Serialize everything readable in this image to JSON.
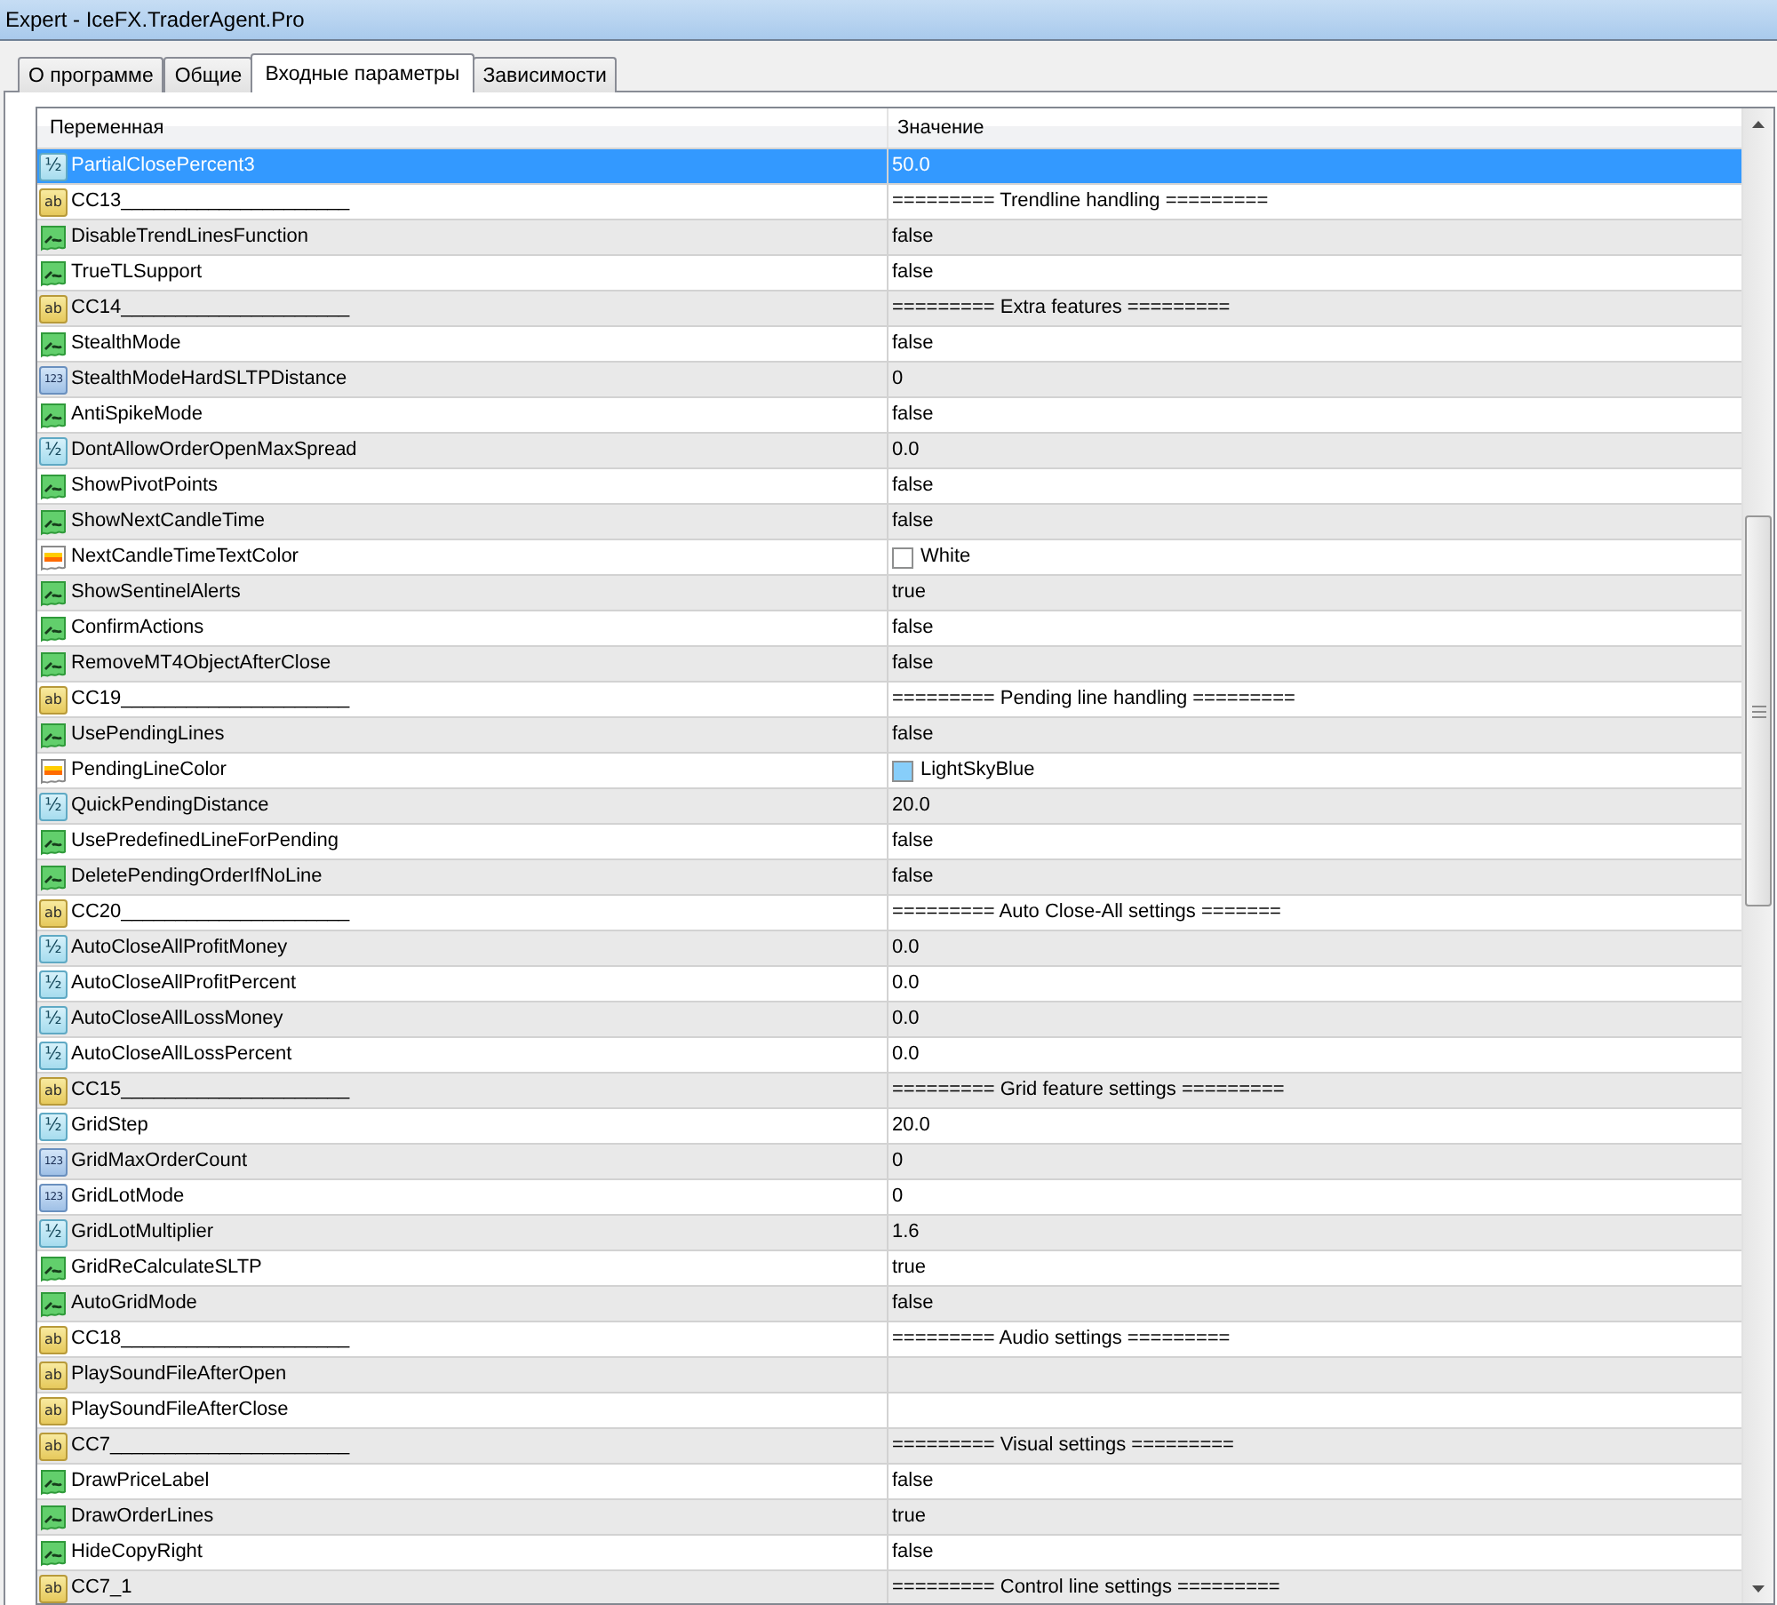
{
  "window": {
    "title": "Expert - IceFX.TraderAgent.Pro"
  },
  "tabs": [
    {
      "label": "О программе",
      "selected": false
    },
    {
      "label": "Общие",
      "selected": false
    },
    {
      "label": "Входные параметры",
      "selected": true
    },
    {
      "label": "Зависимости",
      "selected": false
    }
  ],
  "table": {
    "columns": [
      "Переменная",
      "Значение"
    ],
    "rows": [
      {
        "kind": "double",
        "icon_text": "½",
        "name": "PartialClosePercent3",
        "value": "50.0",
        "selected": true
      },
      {
        "kind": "string",
        "icon_text": "ab",
        "name": "CC13_____________________",
        "value": "========= Trendline handling =========",
        "selected": false
      },
      {
        "kind": "bool",
        "name": "DisableTrendLinesFunction",
        "value": "false",
        "selected": false
      },
      {
        "kind": "bool",
        "name": "TrueTLSupport",
        "value": "false",
        "selected": false
      },
      {
        "kind": "string",
        "icon_text": "ab",
        "name": "CC14_____________________",
        "value": "========= Extra features =========",
        "selected": false
      },
      {
        "kind": "bool",
        "name": "StealthMode",
        "value": "false",
        "selected": false
      },
      {
        "kind": "int",
        "icon_text": "123",
        "name": "StealthModeHardSLTPDistance",
        "value": "0",
        "selected": false
      },
      {
        "kind": "bool",
        "name": "AntiSpikeMode",
        "value": "false",
        "selected": false
      },
      {
        "kind": "double",
        "icon_text": "½",
        "name": "DontAllowOrderOpenMaxSpread",
        "value": "0.0",
        "selected": false
      },
      {
        "kind": "bool",
        "name": "ShowPivotPoints",
        "value": "false",
        "selected": false
      },
      {
        "kind": "bool",
        "name": "ShowNextCandleTime",
        "value": "false",
        "selected": false
      },
      {
        "kind": "color",
        "name": "NextCandleTimeTextColor",
        "value": "White",
        "color": "#ffffff",
        "selected": false
      },
      {
        "kind": "bool",
        "name": "ShowSentinelAlerts",
        "value": "true",
        "selected": false
      },
      {
        "kind": "bool",
        "name": "ConfirmActions",
        "value": "false",
        "selected": false
      },
      {
        "kind": "bool",
        "name": "RemoveMT4ObjectAfterClose",
        "value": "false",
        "selected": false
      },
      {
        "kind": "string",
        "icon_text": "ab",
        "name": "CC19_____________________",
        "value": "========= Pending line handling =========",
        "selected": false
      },
      {
        "kind": "bool",
        "name": "UsePendingLines",
        "value": "false",
        "selected": false
      },
      {
        "kind": "color",
        "name": "PendingLineColor",
        "value": "LightSkyBlue",
        "color": "#87cefa",
        "selected": false
      },
      {
        "kind": "double",
        "icon_text": "½",
        "name": "QuickPendingDistance",
        "value": "20.0",
        "selected": false
      },
      {
        "kind": "bool",
        "name": "UsePredefinedLineForPending",
        "value": "false",
        "selected": false
      },
      {
        "kind": "bool",
        "name": "DeletePendingOrderIfNoLine",
        "value": "false",
        "selected": false
      },
      {
        "kind": "string",
        "icon_text": "ab",
        "name": "CC20_____________________",
        "value": "========= Auto Close-All settings =======",
        "selected": false
      },
      {
        "kind": "double",
        "icon_text": "½",
        "name": "AutoCloseAllProfitMoney",
        "value": "0.0",
        "selected": false
      },
      {
        "kind": "double",
        "icon_text": "½",
        "name": "AutoCloseAllProfitPercent",
        "value": "0.0",
        "selected": false
      },
      {
        "kind": "double",
        "icon_text": "½",
        "name": "AutoCloseAllLossMoney",
        "value": "0.0",
        "selected": false
      },
      {
        "kind": "double",
        "icon_text": "½",
        "name": "AutoCloseAllLossPercent",
        "value": "0.0",
        "selected": false
      },
      {
        "kind": "string",
        "icon_text": "ab",
        "name": "CC15_____________________",
        "value": "========= Grid feature settings =========",
        "selected": false
      },
      {
        "kind": "double",
        "icon_text": "½",
        "name": "GridStep",
        "value": "20.0",
        "selected": false
      },
      {
        "kind": "int",
        "icon_text": "123",
        "name": "GridMaxOrderCount",
        "value": "0",
        "selected": false
      },
      {
        "kind": "int",
        "icon_text": "123",
        "name": "GridLotMode",
        "value": "0",
        "selected": false
      },
      {
        "kind": "double",
        "icon_text": "½",
        "name": "GridLotMultiplier",
        "value": "1.6",
        "selected": false
      },
      {
        "kind": "bool",
        "name": "GridReCalculateSLTP",
        "value": "true",
        "selected": false
      },
      {
        "kind": "bool",
        "name": "AutoGridMode",
        "value": "false",
        "selected": false
      },
      {
        "kind": "string",
        "icon_text": "ab",
        "name": "CC18_____________________",
        "value": "========= Audio settings =========",
        "selected": false
      },
      {
        "kind": "string",
        "icon_text": "ab",
        "name": "PlaySoundFileAfterOpen",
        "selected": false
      },
      {
        "kind": "string",
        "icon_text": "ab",
        "name": "PlaySoundFileAfterClose",
        "selected": false
      },
      {
        "kind": "string",
        "icon_text": "ab",
        "name": "CC7______________________",
        "value": "========= Visual settings =========",
        "selected": false
      },
      {
        "kind": "bool",
        "name": "DrawPriceLabel",
        "value": "false",
        "selected": false
      },
      {
        "kind": "bool",
        "name": "DrawOrderLines",
        "value": "true",
        "selected": false
      },
      {
        "kind": "bool",
        "name": "HideCopyRight",
        "value": "false",
        "selected": false
      },
      {
        "kind": "string",
        "icon_text": "ab",
        "name": "CC7_1",
        "value": "========= Control line settings =========",
        "selected": false
      }
    ]
  }
}
